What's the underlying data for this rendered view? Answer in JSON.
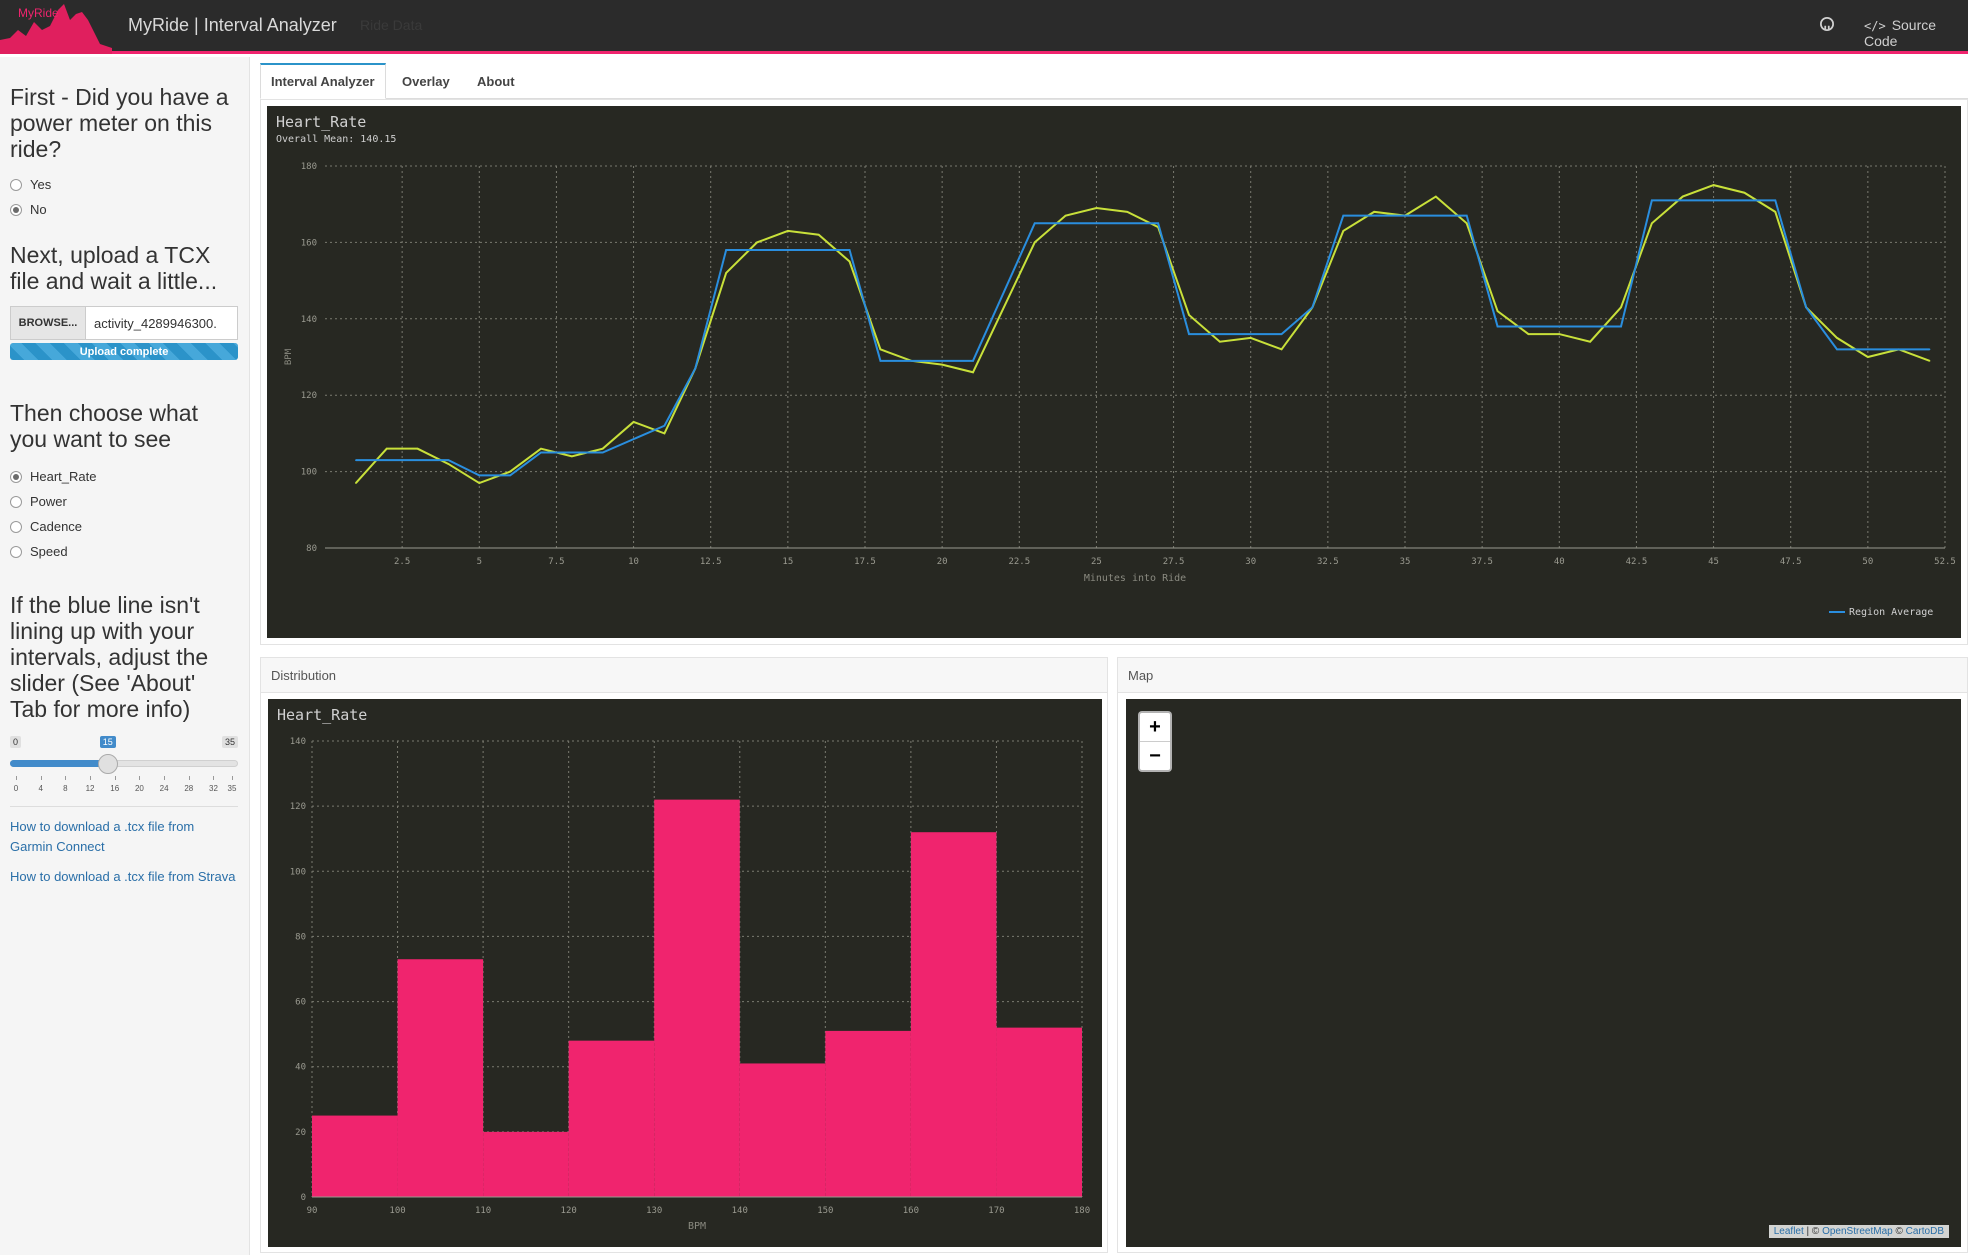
{
  "header": {
    "logo_text": "MyRide",
    "title": "MyRide | Interval Analyzer",
    "ride_data_link": "Ride Data",
    "github_icon": "github-icon",
    "source_code_label": "Source Code",
    "accent_color": "#f0246e"
  },
  "sidebar": {
    "power_question": "First - Did you have a power meter on this ride?",
    "power_options": [
      "Yes",
      "No"
    ],
    "power_selected": "No",
    "upload_heading": "Next, upload a TCX file and wait a little...",
    "browse_label": "BROWSE...",
    "file_name": "activity_4289946300.",
    "upload_status": "Upload complete",
    "upload_progress": 1.0,
    "metric_heading": "Then choose what you want to see",
    "metric_options": [
      "Heart_Rate",
      "Power",
      "Cadence",
      "Speed"
    ],
    "metric_selected": "Heart_Rate",
    "slider_heading": "If the blue line isn't lining up with your intervals, adjust the slider (See 'About' Tab for more info)",
    "slider": {
      "min": 0,
      "max": 35,
      "value": 15,
      "ticks": [
        "0",
        "4",
        "8",
        "12",
        "16",
        "20",
        "24",
        "28",
        "32",
        "35"
      ]
    },
    "links": [
      "How to download a .tcx file from Garmin Connect",
      "How to download a .tcx file from Strava"
    ]
  },
  "tabs": [
    {
      "label": "Interval Analyzer",
      "active": true
    },
    {
      "label": "Overlay",
      "active": false
    },
    {
      "label": "About",
      "active": false
    }
  ],
  "distribution_panel_title": "Distribution",
  "map_panel": {
    "title": "Map",
    "zoom_in": "+",
    "zoom_out": "−",
    "attribution": [
      "Leaflet",
      " | © ",
      "OpenStreetMap",
      " © ",
      "CartoDB"
    ]
  },
  "chart_data": [
    {
      "type": "line",
      "title": "Heart_Rate",
      "subtitle": "Overall Mean: 140.15",
      "xlabel": "Minutes into Ride",
      "ylabel": "BPM",
      "xlim": [
        0,
        52.5
      ],
      "ylim": [
        80,
        180
      ],
      "x_ticks": [
        2.5,
        5,
        7.5,
        10,
        12.5,
        15,
        17.5,
        20,
        22.5,
        25,
        27.5,
        30,
        32.5,
        35,
        37.5,
        40,
        42.5,
        45,
        47.5,
        50,
        52.5
      ],
      "y_ticks": [
        80,
        100,
        120,
        140,
        160,
        180
      ],
      "grid": true,
      "legend_position": "bottom-right",
      "series": [
        {
          "color": "#c8e03a",
          "x": [
            1,
            2,
            3,
            4,
            5,
            6,
            7,
            8,
            9,
            10,
            11,
            12,
            13,
            14,
            15,
            16,
            17,
            18,
            19,
            20,
            21,
            22,
            23,
            24,
            25,
            26,
            27,
            28,
            29,
            30,
            31,
            32,
            33,
            34,
            35,
            36,
            37,
            38,
            39,
            40,
            41,
            42,
            43,
            44,
            45,
            46,
            47,
            48,
            49,
            50,
            51,
            52
          ],
          "values": [
            97,
            106,
            106,
            102,
            97,
            100,
            106,
            104,
            106,
            113,
            110,
            127,
            152,
            160,
            163,
            162,
            155,
            132,
            129,
            128,
            126,
            143,
            160,
            167,
            169,
            168,
            164,
            141,
            134,
            135,
            132,
            143,
            163,
            168,
            167,
            172,
            165,
            142,
            136,
            136,
            134,
            143,
            165,
            172,
            175,
            173,
            168,
            143,
            135,
            130,
            132,
            129
          ]
        },
        {
          "name": "Region Average",
          "color": "#2a8ede",
          "x": [
            1,
            4,
            5,
            6,
            7,
            9,
            11,
            12,
            13,
            17,
            18,
            21,
            23,
            27,
            28,
            31,
            32,
            33,
            37,
            38,
            42,
            43,
            47,
            48,
            49,
            52
          ],
          "values": [
            103,
            103,
            99,
            99,
            105,
            105,
            112,
            127,
            158,
            158,
            129,
            129,
            165,
            165,
            136,
            136,
            143,
            167,
            167,
            138,
            138,
            171,
            171,
            143,
            132,
            132
          ]
        }
      ]
    },
    {
      "type": "bar",
      "title": "Heart_Rate",
      "xlabel": "BPM",
      "ylabel": "",
      "bins": [
        90,
        100,
        110,
        120,
        130,
        140,
        150,
        160,
        170,
        180
      ],
      "values": [
        25,
        73,
        20,
        48,
        122,
        41,
        51,
        112,
        52
      ],
      "color": "#f0246e",
      "xlim": [
        90,
        180
      ],
      "ylim": [
        0,
        140
      ],
      "x_ticks": [
        90,
        100,
        110,
        120,
        130,
        140,
        150,
        160,
        170,
        180
      ],
      "y_ticks": [
        0,
        20,
        40,
        60,
        80,
        100,
        120,
        140
      ],
      "grid": true
    }
  ]
}
